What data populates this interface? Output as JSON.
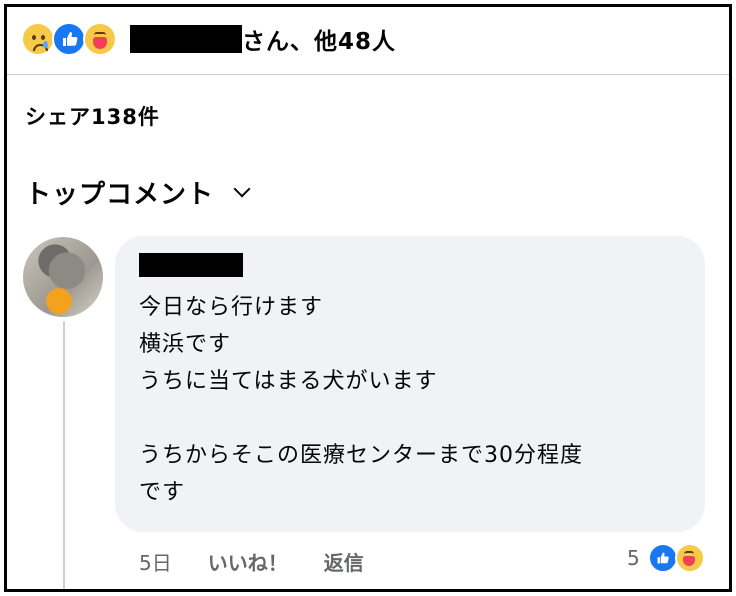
{
  "post": {
    "reaction_icons": [
      "sad-emoji-icon",
      "like-thumb-icon",
      "care-emoji-icon"
    ],
    "reaction_text": "さん、他48人",
    "shares": "シェア138件",
    "top_comments": "トップコメント"
  },
  "comment": {
    "lines": [
      "今日なら行けます",
      "横浜です",
      "うちに当てはまる犬がいます",
      "",
      "うちからそこの医療センターまで30分程度",
      "です"
    ],
    "time": "5日",
    "like_label": "いいね！",
    "reply_label": "返信",
    "reaction_count": "5",
    "reaction_icons": [
      "like-thumb-icon",
      "care-emoji-icon"
    ]
  },
  "colors": {
    "like_blue": "#1877f2",
    "bubble_bg": "#f0f2f5",
    "muted_text": "#65676b"
  }
}
